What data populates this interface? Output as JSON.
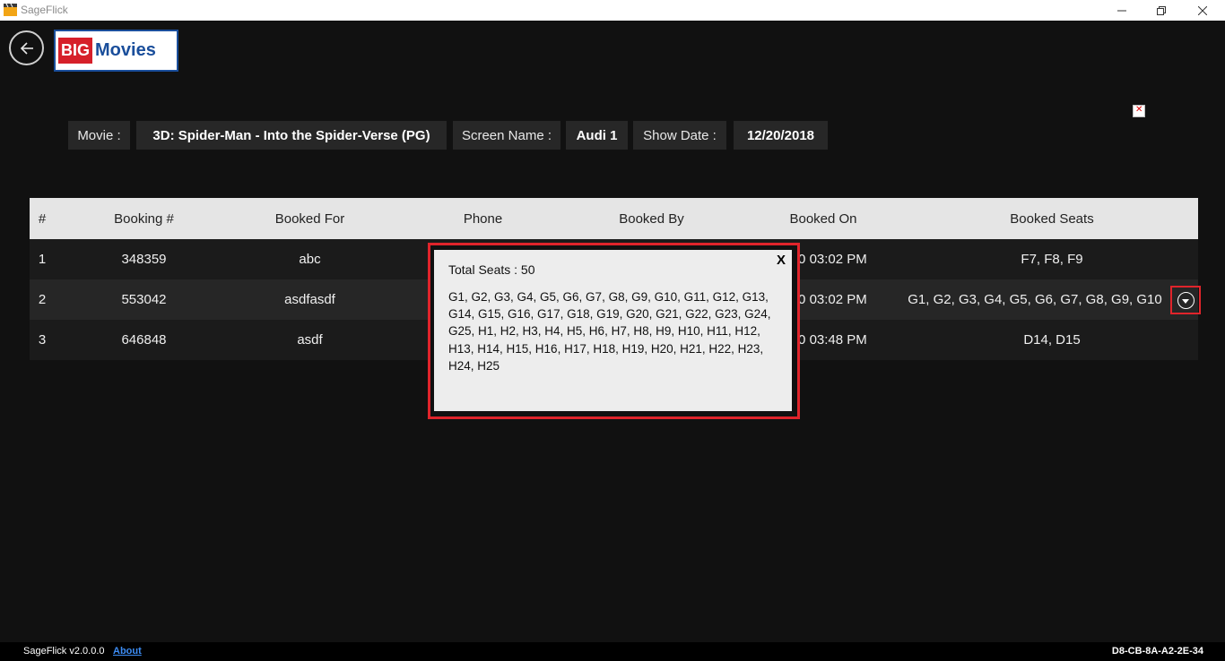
{
  "window": {
    "title": "SageFlick",
    "minimize_glyph": "—",
    "maximize_glyph": "❐",
    "close_glyph": "✕"
  },
  "header": {
    "logo": {
      "big": "BIG",
      "movies": "Movies"
    },
    "back_icon": "back-arrow-icon"
  },
  "info": {
    "movie_label": "Movie :",
    "movie_value": "3D: Spider-Man - Into the Spider-Verse (PG)",
    "screen_label": "Screen Name :",
    "screen_value": "Audi 1",
    "date_label": "Show Date :",
    "date_value": "12/20/2018"
  },
  "table": {
    "headers": [
      "#",
      "Booking #",
      "Booked For",
      "Phone",
      "Booked By",
      "Booked On",
      "Booked Seats"
    ],
    "rows": [
      {
        "idx": "1",
        "booking": "348359",
        "for": "abc",
        "phone": "",
        "by": "",
        "on": "2:20 03:02 PM",
        "seats": "F7, F8, F9"
      },
      {
        "idx": "2",
        "booking": "553042",
        "for": "asdfasdf",
        "phone": "",
        "by": "",
        "on": "2:20 03:02 PM",
        "seats": "G1, G2, G3, G4, G5, G6, G7, G8, G9, G10"
      },
      {
        "idx": "3",
        "booking": "646848",
        "for": "asdf",
        "phone": "",
        "by": "",
        "on": "2:20 03:48 PM",
        "seats": "D14, D15"
      }
    ]
  },
  "popup": {
    "total": "Total Seats : 50",
    "close": "X",
    "seats": " G1, G2, G3, G4, G5, G6, G7, G8, G9, G10, G11, G12, G13, G14, G15, G16, G17, G18, G19, G20, G21, G22, G23, G24, G25, H1, H2, H3, H4, H5, H6, H7, H8, H9, H10, H11, H12, H13, H14, H15, H16, H17, H18, H19, H20, H21, H22, H23, H24, H25"
  },
  "footer": {
    "version": "SageFlick v2.0.0.0",
    "about": "About",
    "mac": "D8-CB-8A-A2-2E-34"
  },
  "colors": {
    "accent_red": "#e0242b",
    "background": "#111111",
    "link_blue": "#3d8df5"
  }
}
